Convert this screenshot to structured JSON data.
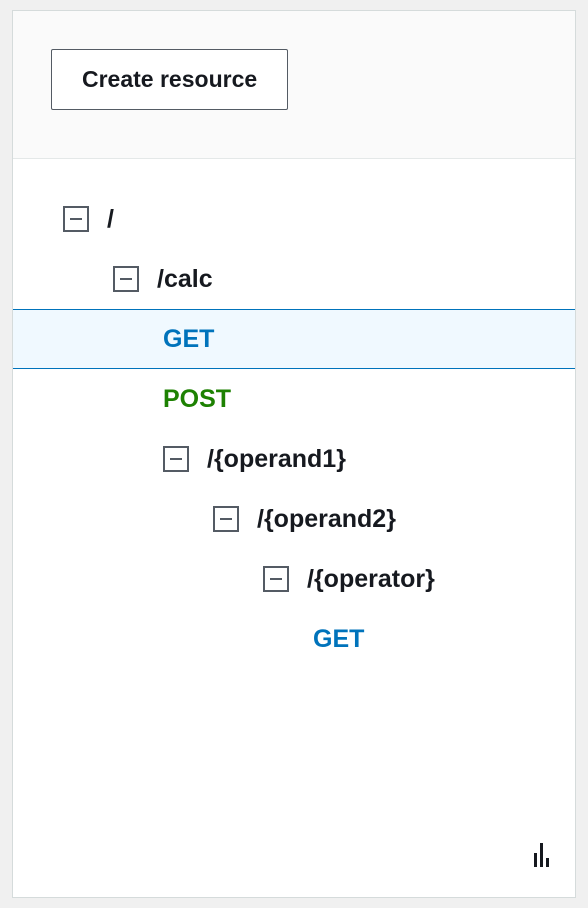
{
  "toolbar": {
    "create_resource_label": "Create resource"
  },
  "tree": {
    "root": {
      "label": "/"
    },
    "calc": {
      "label": "/calc"
    },
    "calc_get": {
      "label": "GET"
    },
    "calc_post": {
      "label": "POST"
    },
    "operand1": {
      "label": "/{operand1}"
    },
    "operand2": {
      "label": "/{operand2}"
    },
    "operator": {
      "label": "/{operator}"
    },
    "operator_get": {
      "label": "GET"
    }
  }
}
